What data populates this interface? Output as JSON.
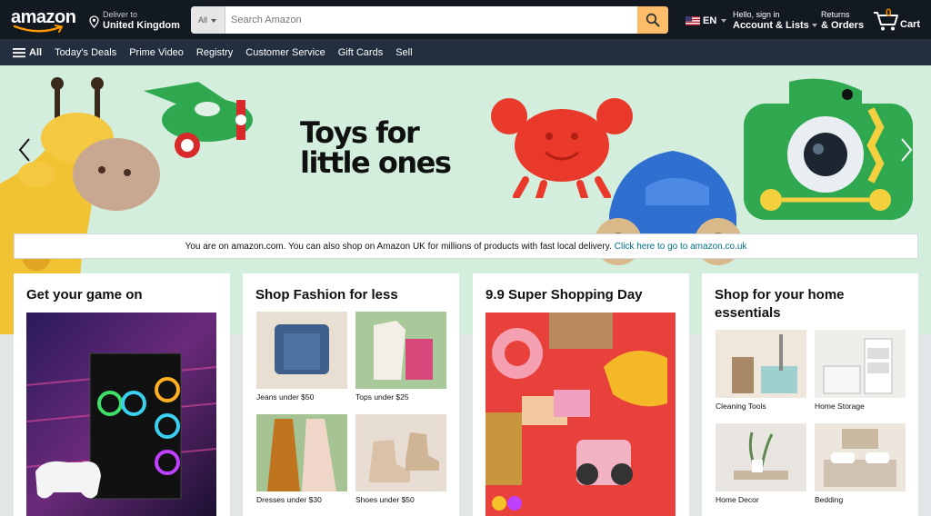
{
  "header": {
    "logo_text": "amazon",
    "deliver_line1": "Deliver to",
    "deliver_line2": "United Kingdom",
    "search_category": "All",
    "search_placeholder": "Search Amazon",
    "language": "EN",
    "account_line1": "Hello, sign in",
    "account_line2": "Account & Lists",
    "returns_line1": "Returns",
    "returns_line2": "& Orders",
    "cart_count": "0",
    "cart_label": "Cart"
  },
  "subnav": {
    "all_label": "All",
    "items": [
      "Today's Deals",
      "Prime Video",
      "Registry",
      "Customer Service",
      "Gift Cards",
      "Sell"
    ]
  },
  "hero": {
    "title_line1": "Toys for",
    "title_line2": "little ones"
  },
  "notice": {
    "text": "You are on amazon.com. You can also shop on Amazon UK for millions of products with fast local delivery.",
    "link": "Click here to go to amazon.co.uk"
  },
  "cards": [
    {
      "title": "Get your game on"
    },
    {
      "title": "Shop Fashion for less",
      "tiles": [
        "Jeans under $50",
        "Tops under $25",
        "Dresses under $30",
        "Shoes under $50"
      ]
    },
    {
      "title": "9.9 Super Shopping Day"
    },
    {
      "title": "Shop for your home essentials",
      "tiles": [
        "Cleaning Tools",
        "Home Storage",
        "Home Decor",
        "Bedding"
      ]
    }
  ],
  "colors": {
    "nav_bg": "#131921",
    "subnav_bg": "#232f3e",
    "search_button": "#febd69",
    "cart_count": "#f08804",
    "hero_bg": "#d3eedd",
    "link": "#007185"
  }
}
